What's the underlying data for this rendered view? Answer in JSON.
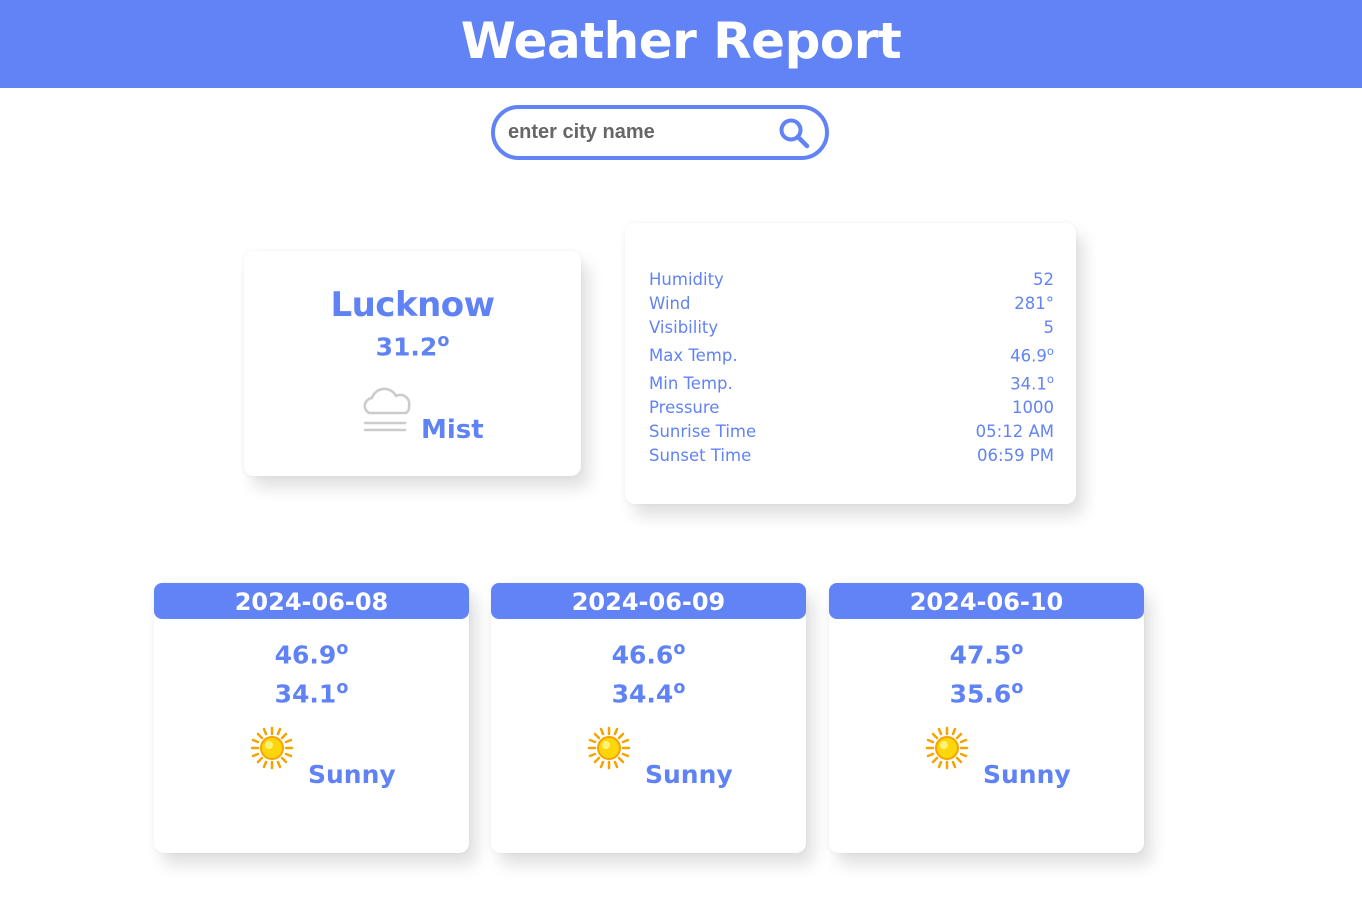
{
  "header": {
    "title": "Weather Report"
  },
  "search": {
    "placeholder": "enter city name",
    "value": ""
  },
  "current": {
    "city": "Lucknow",
    "temp": "31.2",
    "temp_unit": "o",
    "condition": "Mist",
    "icon": "mist-icon"
  },
  "details": [
    {
      "label": "Humidity",
      "value": "52"
    },
    {
      "label": "Wind",
      "value": "281°"
    },
    {
      "label": "Visibility",
      "value": "5"
    },
    {
      "label": "Max Temp.",
      "value": "46.9",
      "unit": "o"
    },
    {
      "label": "Min Temp.",
      "value": "34.1",
      "unit": "o"
    },
    {
      "label": "Pressure",
      "value": "1000"
    },
    {
      "label": "Sunrise Time",
      "value": "05:12 AM"
    },
    {
      "label": "Sunset Time",
      "value": "06:59 PM"
    }
  ],
  "forecast": [
    {
      "date": "2024-06-08",
      "max": "46.9",
      "min": "34.1",
      "unit": "o",
      "condition": "Sunny",
      "icon": "sun-icon"
    },
    {
      "date": "2024-06-09",
      "max": "46.6",
      "min": "34.4",
      "unit": "o",
      "condition": "Sunny",
      "icon": "sun-icon"
    },
    {
      "date": "2024-06-10",
      "max": "47.5",
      "min": "35.6",
      "unit": "o",
      "condition": "Sunny",
      "icon": "sun-icon"
    }
  ],
  "colors": {
    "accent": "#6183f5",
    "background": "#ffffff",
    "icon_grey": "#cccccc",
    "sun_yellow": "#ffd60a",
    "sun_orange": "#f5a300"
  }
}
